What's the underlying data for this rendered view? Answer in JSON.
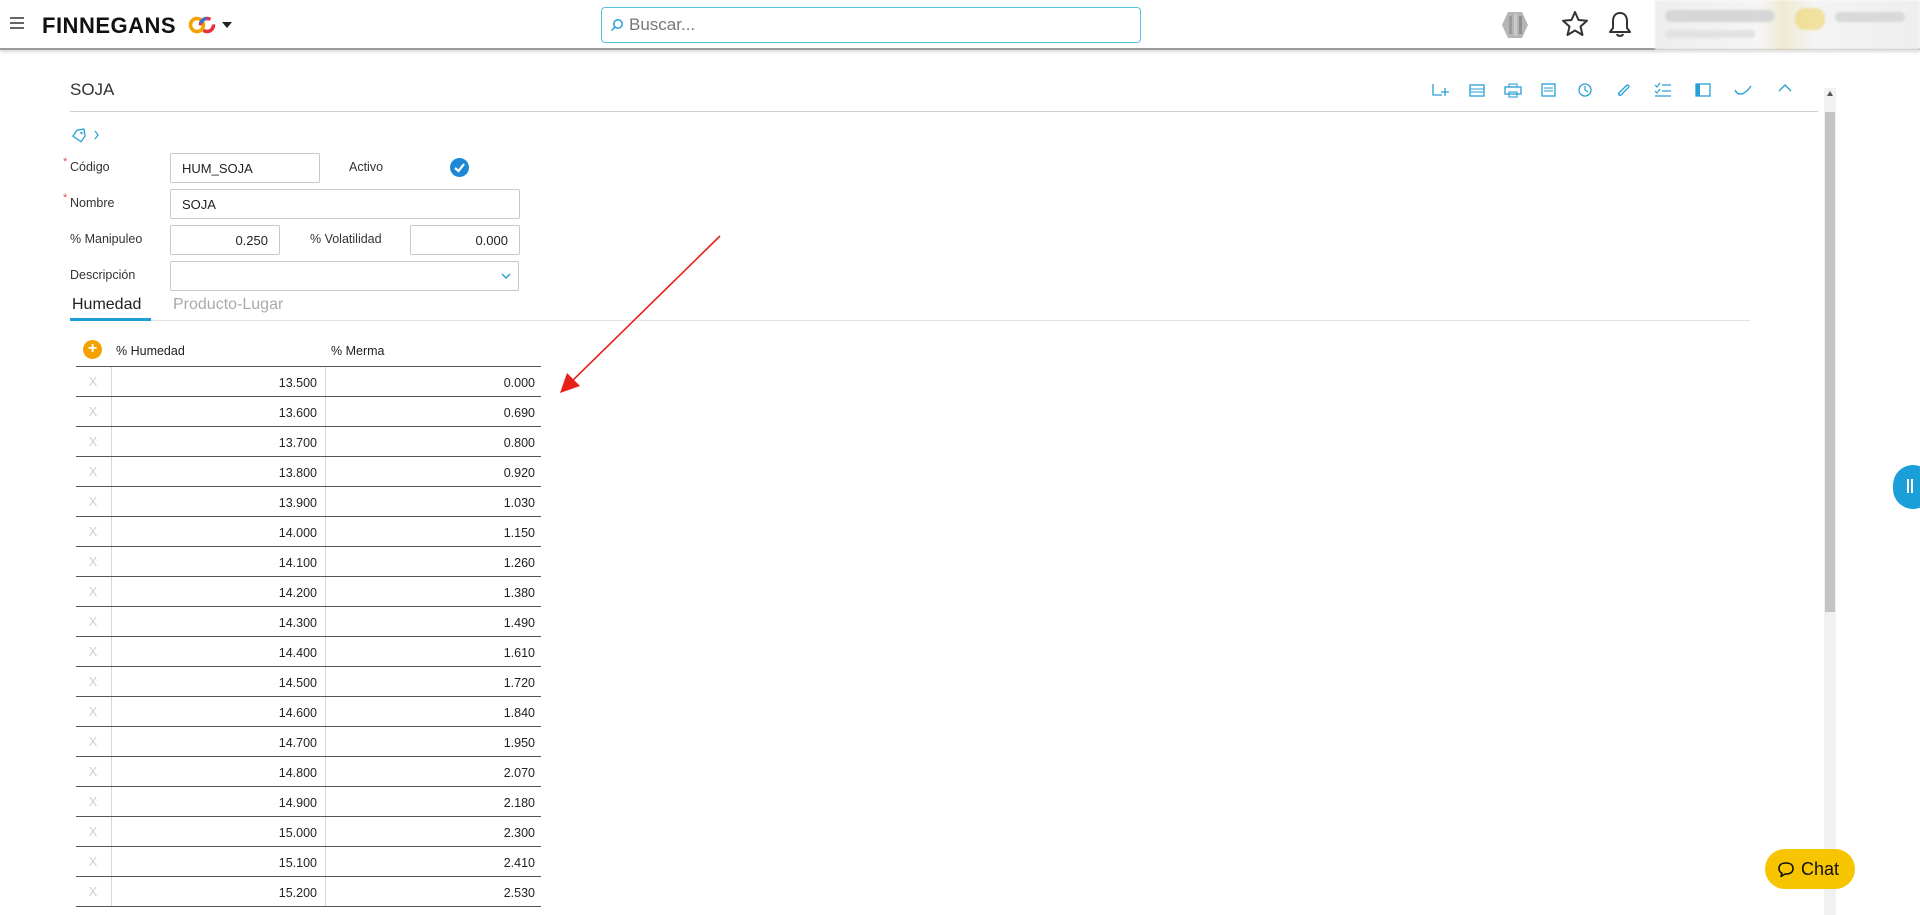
{
  "header": {
    "brand": "FINNEGANS",
    "search_placeholder": "Buscar...",
    "icons": [
      "menu-icon",
      "brand-logo-icon",
      "search-icon",
      "apps-icon",
      "star-icon",
      "bell-icon"
    ]
  },
  "record": {
    "title": "SOJA",
    "toolbar_icons": [
      "new-icon",
      "list-icon",
      "print-icon",
      "copy-icon",
      "history-icon",
      "attach-icon",
      "checklist-icon",
      "notes-icon",
      "check-icon",
      "collapse-icon"
    ]
  },
  "form": {
    "codigo_label": "Código",
    "codigo_value": "HUM_SOJA",
    "activo_label": "Activo",
    "activo_checked": true,
    "nombre_label": "Nombre",
    "nombre_value": "SOJA",
    "manipuleo_label": "% Manipuleo",
    "manipuleo_value": "0.250",
    "volatilidad_label": "% Volatilidad",
    "volatilidad_value": "0.000",
    "descripcion_label": "Descripción",
    "descripcion_value": "",
    "required_mark": "*"
  },
  "tabs": [
    {
      "label": "Humedad",
      "active": true
    },
    {
      "label": "Producto-Lugar",
      "active": false
    }
  ],
  "grid": {
    "add_symbol": "+",
    "delete_symbol": "X",
    "columns": [
      "% Humedad",
      "% Merma"
    ],
    "rows": [
      [
        "13.500",
        "0.000"
      ],
      [
        "13.600",
        "0.690"
      ],
      [
        "13.700",
        "0.800"
      ],
      [
        "13.800",
        "0.920"
      ],
      [
        "13.900",
        "1.030"
      ],
      [
        "14.000",
        "1.150"
      ],
      [
        "14.100",
        "1.260"
      ],
      [
        "14.200",
        "1.380"
      ],
      [
        "14.300",
        "1.490"
      ],
      [
        "14.400",
        "1.610"
      ],
      [
        "14.500",
        "1.720"
      ],
      [
        "14.600",
        "1.840"
      ],
      [
        "14.700",
        "1.950"
      ],
      [
        "14.800",
        "2.070"
      ],
      [
        "14.900",
        "2.180"
      ],
      [
        "15.000",
        "2.300"
      ],
      [
        "15.100",
        "2.410"
      ],
      [
        "15.200",
        "2.530"
      ]
    ]
  },
  "chat": {
    "label": "Chat"
  },
  "colors": {
    "accent": "#1a9fd8",
    "add_button": "#f5a200",
    "chat_button": "#f7c400",
    "annotation_arrow": "#e8201a"
  }
}
